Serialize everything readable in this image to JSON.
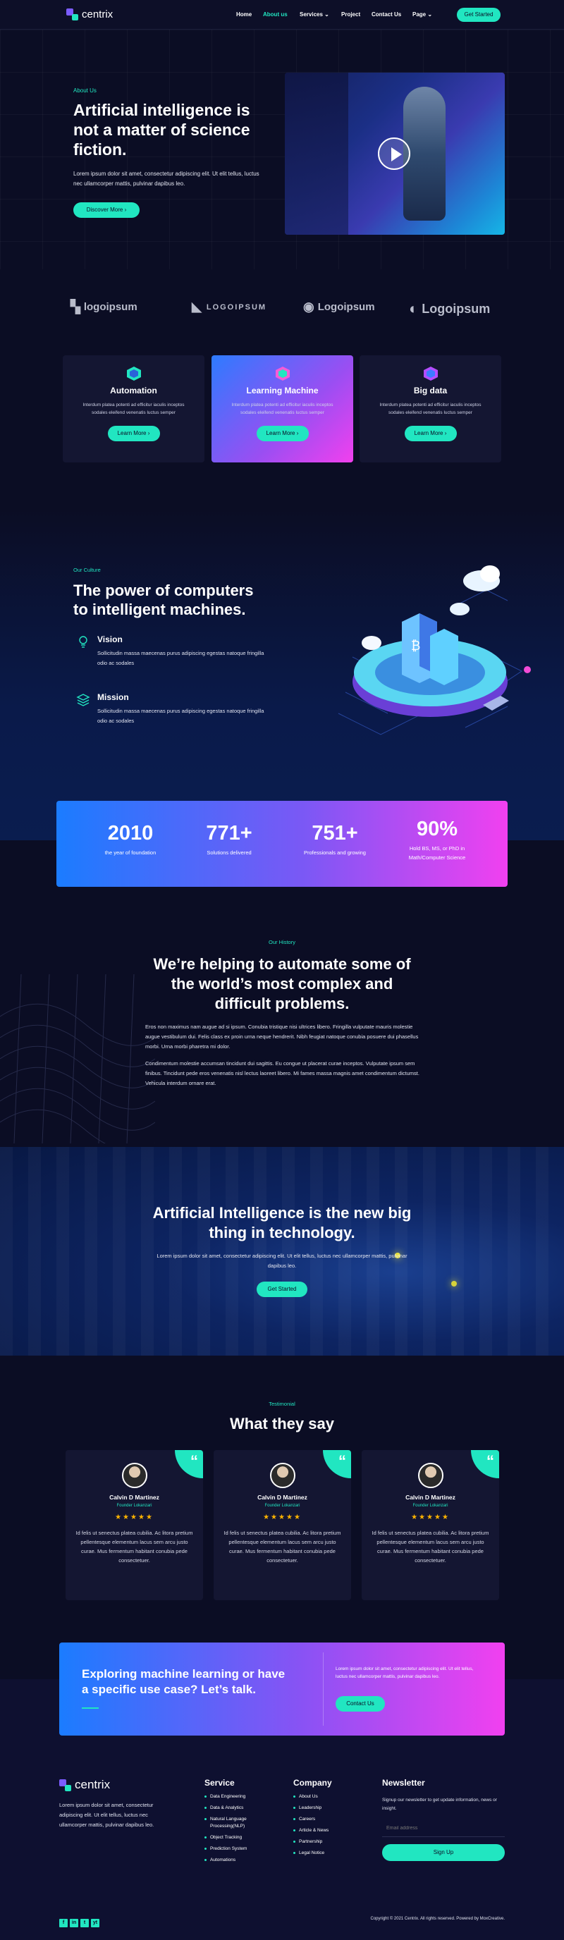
{
  "brand": {
    "name": "centrix"
  },
  "nav": {
    "items": [
      {
        "label": "Home"
      },
      {
        "label": "About us"
      },
      {
        "label": "Services"
      },
      {
        "label": "Project"
      },
      {
        "label": "Contact Us"
      },
      {
        "label": "Page"
      }
    ],
    "active": "About us",
    "cta": "Get Started"
  },
  "hero": {
    "eyebrow": "About Us",
    "title": "Artificial intelligence is not a matter of science fiction.",
    "text": "Lorem ipsum dolor sit amet, consectetur adipiscing elit. Ut elit tellus, luctus nec ullamcorper mattis, pulvinar dapibus leo.",
    "button": "Discover More"
  },
  "logos": [
    {
      "label": "logoipsum"
    },
    {
      "label": "LOGOIPSUM"
    },
    {
      "label": "Logoipsum"
    },
    {
      "label": "Logoipsum"
    }
  ],
  "features": [
    {
      "title": "Automation",
      "text": "Interdum platea potenti ad efficitur iaculis inceptos sodales eleifend venenatis luctus semper",
      "button": "Learn More"
    },
    {
      "title": "Learning Machine",
      "text": "Interdum platea potenti ad efficitur iaculis inceptos sodales eleifend venenatis luctus semper",
      "button": "Learn More"
    },
    {
      "title": "Big data",
      "text": "Interdum platea potenti ad efficitur iaculis inceptos sodales eleifend venenatis luctus semper",
      "button": "Learn More"
    }
  ],
  "culture": {
    "eyebrow": "Our Culture",
    "title": "The power of computers to intelligent machines.",
    "items": [
      {
        "title": "Vision",
        "text": "Sollicitudin massa maecenas purus adipiscing egestas natoque fringilla odio ac sodales"
      },
      {
        "title": "Mission",
        "text": "Sollicitudin massa maecenas purus adipiscing egestas natoque fringilla odio ac sodales"
      }
    ]
  },
  "stats": [
    {
      "value": "2010",
      "label": "the year of foundation"
    },
    {
      "value": "771+",
      "label": "Solutions delivered"
    },
    {
      "value": "751+",
      "label": "Professionals and growing"
    },
    {
      "value": "90%",
      "label": "Hold BS, MS, or PhD in Math/Computer Science"
    }
  ],
  "history": {
    "eyebrow": "Our History",
    "title": "We’re helping to automate some of the world’s most complex and difficult problems.",
    "p1": "Eros non maximus nam augue ad si ipsum. Conubia tristique nisi ultrices libero. Fringilla vulputate mauris molestie augue vestibulum dui. Felis class ex proin urna neque hendrerit. Nibh feugiat natoque conubia posuere dui phasellus morbi. Urna morbi pharetra mi dolor.",
    "p2": "Condimentum molestie accumsan tincidunt dui sagittis. Eu congue ut placerat curae inceptos. Vulputate ipsum sem finibus. Tincidunt pede eros venenatis nisl lectus laoreet libero. Mi fames massa magnis amet condimentum dictumst. Vehicula interdum ornare erat."
  },
  "banner": {
    "title": "Artificial Intelligence is the new big thing in technology.",
    "text": "Lorem ipsum dolor sit amet, consectetur adipiscing elit. Ut elit tellus, luctus nec ullamcorper mattis, pulvinar dapibus leo.",
    "button": "Get Started"
  },
  "testimonials": {
    "eyebrow": "Testimonial",
    "title": "What they say",
    "items": [
      {
        "name": "Calvin D Martinez",
        "role": "Founder Lokanzari",
        "rating": 5,
        "text": "Id felis ut senectus platea cubilia. Ac litora pretium pellentesque elementum lacus sem arcu justo curae. Mus fermentum habitant conubia pede consectetuer."
      },
      {
        "name": "Calvin D Martinez",
        "role": "Founder Lokanzari",
        "rating": 5,
        "text": "Id felis ut senectus platea cubilia. Ac litora pretium pellentesque elementum lacus sem arcu justo curae. Mus fermentum habitant conubia pede consectetuer."
      },
      {
        "name": "Calvin D Martinez",
        "role": "Founder Lokanzari",
        "rating": 5,
        "text": "Id felis ut senectus platea cubilia. Ac litora pretium pellentesque elementum lacus sem arcu justo curae. Mus fermentum habitant conubia pede consectetuer."
      }
    ]
  },
  "cta": {
    "title": "Exploring machine learning or have a specific use case? Let’s talk.",
    "text": "Lorem ipsum dolor sit amet, consectetur adipiscing elit. Ut elit tellus, luctus nec ullamcorper mattis, pulvinar dapibus leo.",
    "button": "Contact Us"
  },
  "footer": {
    "about": "Lorem ipsum dolor sit amet, consectetur adipiscing elit. Ut elit tellus, luctus nec ullamcorper mattis, pulvinar dapibus leo.",
    "service": {
      "title": "Service",
      "items": [
        "Data Engineering",
        "Data & Analytics",
        "Natural Language Processing(NLP)",
        "Object Tracking",
        "Prediction System",
        "Automations"
      ]
    },
    "company": {
      "title": "Company",
      "items": [
        "About Us",
        "Leadership",
        "Careers",
        "Article & News",
        "Partnership",
        "Legal Notice"
      ]
    },
    "newsletter": {
      "title": "Newsletter",
      "text": "Signup our newsletter to get update information, news or insight.",
      "placeholder": "Email address",
      "button": "Sign Up"
    },
    "copyright": "Copyright © 2021 Centrix. All rights reserved. Powered by MoxCreative.",
    "social": [
      "f",
      "in",
      "t",
      "yt"
    ]
  },
  "colors": {
    "accent": "#21e6c1",
    "bg": "#0b0d24",
    "gradient_start": "#1b7cff",
    "gradient_end": "#f140f0"
  }
}
